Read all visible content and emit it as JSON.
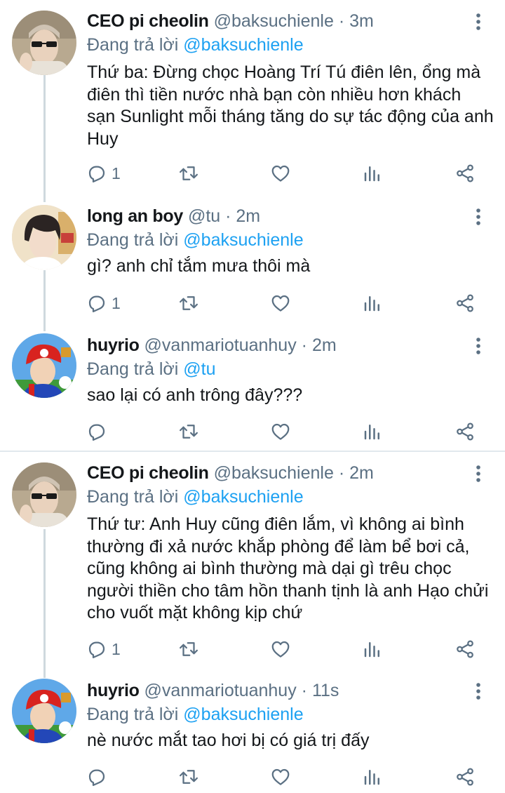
{
  "colors": {
    "text": "#14171a",
    "secondary": "#5b7083",
    "accent": "#1da1f2",
    "thread_line": "#cfd9de"
  },
  "tweets": [
    {
      "name": "CEO pi cheolin",
      "handle": "@baksuchienle",
      "sep": "·",
      "time": "3m",
      "replying_prefix": "Đang trả lời ",
      "replying_to": "@baksuchienle",
      "text": "Thứ ba: Đừng chọc Hoàng Trí Tú điên lên, ổng mà điên thì tiền nước nhà bạn còn nhiều hơn khách sạn Sunlight mỗi tháng tăng do sự tác động của anh Huy",
      "reply_count": "1",
      "avatar": "sunglasses-man-avatar"
    },
    {
      "name": "long an boy",
      "handle": "@tu",
      "sep": "·",
      "time": "2m",
      "replying_prefix": "Đang trả lời ",
      "replying_to": "@baksuchienle",
      "text": "gì? anh chỉ tắm mưa thôi mà",
      "reply_count": "1",
      "avatar": "dark-hair-boy-avatar"
    },
    {
      "name": "huyrio",
      "handle": "@vanmariotuanhuy",
      "sep": "·",
      "time": "2m",
      "replying_prefix": "Đang trả lời ",
      "replying_to": "@tu",
      "text": "sao lại có anh trông đây???",
      "reply_count": "",
      "avatar": "mario-cap-avatar"
    },
    {
      "name": "CEO pi cheolin",
      "handle": "@baksuchienle",
      "sep": "·",
      "time": "2m",
      "replying_prefix": "Đang trả lời ",
      "replying_to": "@baksuchienle",
      "text": "Thứ tư: Anh Huy cũng điên lắm, vì không ai bình thường đi xả nước khắp phòng để làm bể bơi cả, cũng không ai bình thường mà dại gì trêu chọc người thiền cho tâm hồn thanh tịnh là anh Hạo chửi cho vuốt mặt không kịp chứ",
      "reply_count": "1",
      "avatar": "sunglasses-man-avatar"
    },
    {
      "name": "huyrio",
      "handle": "@vanmariotuanhuy",
      "sep": "·",
      "time": "11s",
      "replying_prefix": "Đang trả lời ",
      "replying_to": "@baksuchienle",
      "text": "nè nước mắt tao hơi bị có giá trị đấy",
      "reply_count": "",
      "avatar": "mario-cap-avatar"
    }
  ]
}
